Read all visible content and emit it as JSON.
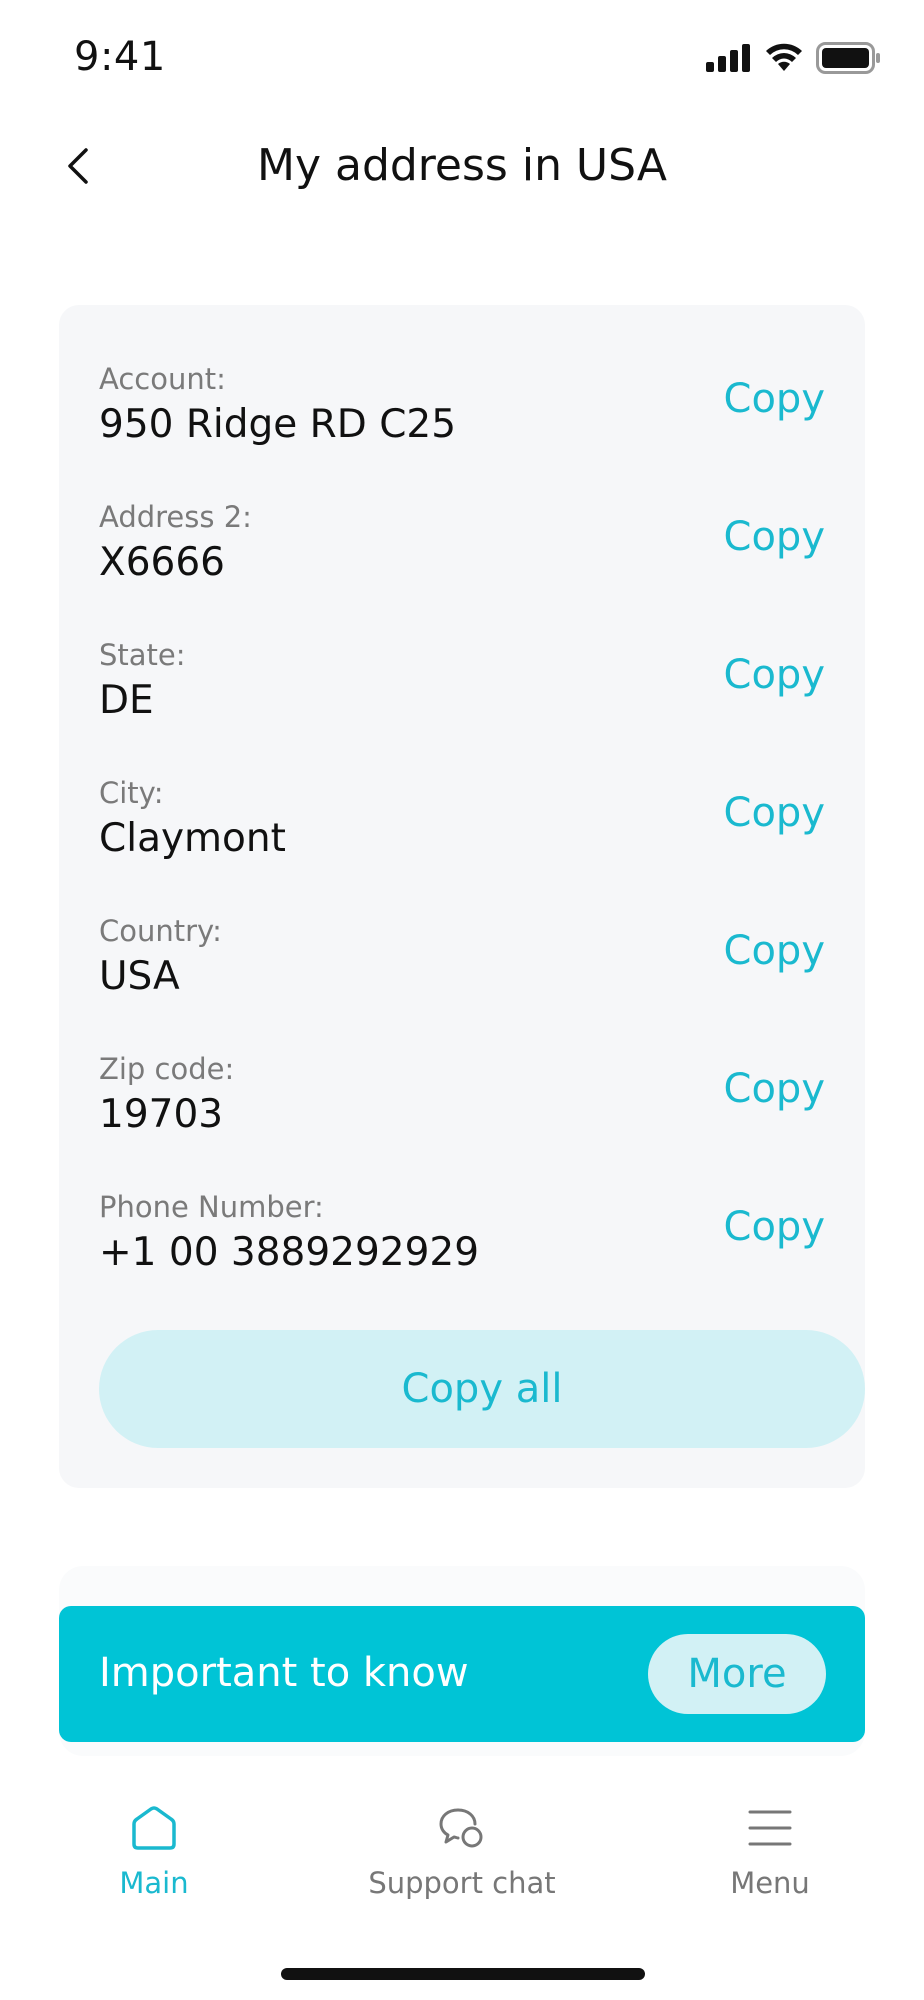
{
  "status_bar": {
    "time": "9:41"
  },
  "header": {
    "title": "My address in USA",
    "back_icon": "chevron-left-icon"
  },
  "address_card": {
    "copy_label": "Copy",
    "fields": [
      {
        "label": "Account:",
        "value": "950 Ridge RD C25"
      },
      {
        "label": "Address 2:",
        "value": "X6666"
      },
      {
        "label": "State:",
        "value": "DE"
      },
      {
        "label": "City:",
        "value": "Claymont"
      },
      {
        "label": "Country:",
        "value": "USA"
      },
      {
        "label": "Zip code:",
        "value": "19703"
      },
      {
        "label": "Phone Number:",
        "value": "+1 00 3889292929"
      }
    ],
    "copy_all_label": "Copy all"
  },
  "banner": {
    "text": "Important to know",
    "more_label": "More"
  },
  "tab_bar": {
    "tabs": [
      {
        "label": "Main",
        "icon": "home-icon",
        "active": true
      },
      {
        "label": "Support chat",
        "icon": "chat-icon",
        "active": false
      },
      {
        "label": "Menu",
        "icon": "menu-icon",
        "active": false
      }
    ]
  },
  "colors": {
    "accent": "#1ab9cf",
    "banner": "#00c4d6",
    "accent_light": "#d2f1f5",
    "card_background": "#f6f7f9"
  }
}
